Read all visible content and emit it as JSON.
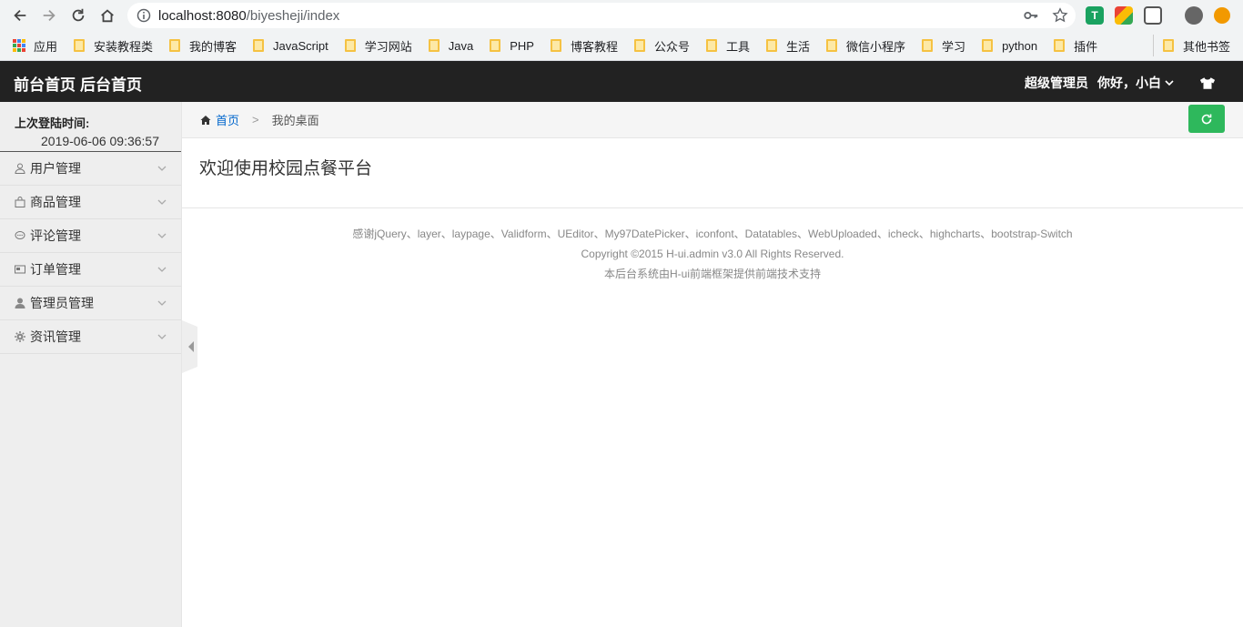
{
  "browser": {
    "url_host": "localhost:8080",
    "url_path": "/biyesheji/index",
    "bookmarks": [
      {
        "label": "应用"
      },
      {
        "label": "安装教程类"
      },
      {
        "label": "我的博客"
      },
      {
        "label": "JavaScript"
      },
      {
        "label": "学习网站"
      },
      {
        "label": "Java"
      },
      {
        "label": "PHP"
      },
      {
        "label": "博客教程"
      },
      {
        "label": "公众号"
      },
      {
        "label": "工具"
      },
      {
        "label": "生活"
      },
      {
        "label": "微信小程序"
      },
      {
        "label": "学习"
      },
      {
        "label": "python"
      },
      {
        "label": "插件"
      }
    ],
    "other_bookmarks": "其他书签"
  },
  "header": {
    "logo": "前台首页",
    "logo_sub": "后台首页",
    "role": "超级管理员",
    "greeting": "你好，小白"
  },
  "sidebar": {
    "login_label": "上次登陆时间:",
    "login_time": "2019-06-06 09:36:57",
    "items": [
      {
        "label": "用户管理",
        "icon": "user-icon"
      },
      {
        "label": "商品管理",
        "icon": "bag-icon"
      },
      {
        "label": "评论管理",
        "icon": "comment-icon"
      },
      {
        "label": "订单管理",
        "icon": "order-icon"
      },
      {
        "label": "管理员管理",
        "icon": "admin-icon"
      },
      {
        "label": "资讯管理",
        "icon": "gear-icon"
      }
    ]
  },
  "breadcrumb": {
    "home": "首页",
    "sep": ">",
    "current": "我的桌面"
  },
  "main": {
    "welcome": "欢迎使用校园点餐平台"
  },
  "footer": {
    "line1": "感谢jQuery、layer、laypage、Validform、UEditor、My97DatePicker、iconfont、Datatables、WebUploaded、icheck、highcharts、bootstrap-Switch",
    "line2": "Copyright ©2015 H-ui.admin v3.0 All Rights Reserved.",
    "line3": "本后台系统由H-ui前端框架提供前端技术支持"
  },
  "colors": {
    "header_bg": "#222222",
    "refresh_btn": "#2eb85c",
    "link": "#0066cc"
  }
}
